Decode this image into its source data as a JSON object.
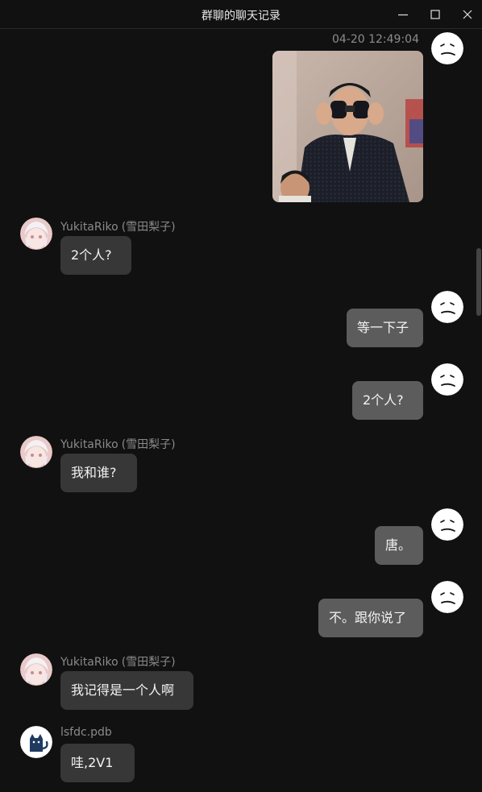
{
  "window": {
    "title": "群聊的聊天记录",
    "minimize_icon": "minimize-icon",
    "maximize_icon": "maximize-icon",
    "close_icon": "close-icon"
  },
  "colors": {
    "background": "#111111",
    "bubble_other": "#373737",
    "bubble_self": "#5c5c5c",
    "sender_name": "#8a8a8a",
    "text": "#f2f2f2"
  },
  "messages": [
    {
      "side": "self",
      "timestamp": "04-20 12:49:04",
      "type": "image",
      "avatar": "meh-face-avatar",
      "image": "photo-man-with-binoculars"
    },
    {
      "side": "other",
      "sender": "YukitaRiko",
      "group_card": "(雪田梨子)",
      "avatar": "anime-girl-avatar",
      "text": "2个人?"
    },
    {
      "side": "self",
      "avatar": "meh-face-avatar",
      "text": "等一下子"
    },
    {
      "side": "self",
      "avatar": "meh-face-avatar",
      "text": "2个人?"
    },
    {
      "side": "other",
      "sender": "YukitaRiko",
      "group_card": "(雪田梨子)",
      "avatar": "anime-girl-avatar",
      "text": "我和谁?"
    },
    {
      "side": "self",
      "avatar": "meh-face-avatar",
      "text": "唐。"
    },
    {
      "side": "self",
      "avatar": "meh-face-avatar",
      "text": "不。跟你说了"
    },
    {
      "side": "other",
      "sender": "YukitaRiko",
      "group_card": "(雪田梨子)",
      "avatar": "anime-girl-avatar",
      "text": "我记得是一个人啊"
    },
    {
      "side": "other",
      "sender": "lsfdc.pdb",
      "avatar": "cat-avatar",
      "text": "哇,2V1"
    }
  ]
}
